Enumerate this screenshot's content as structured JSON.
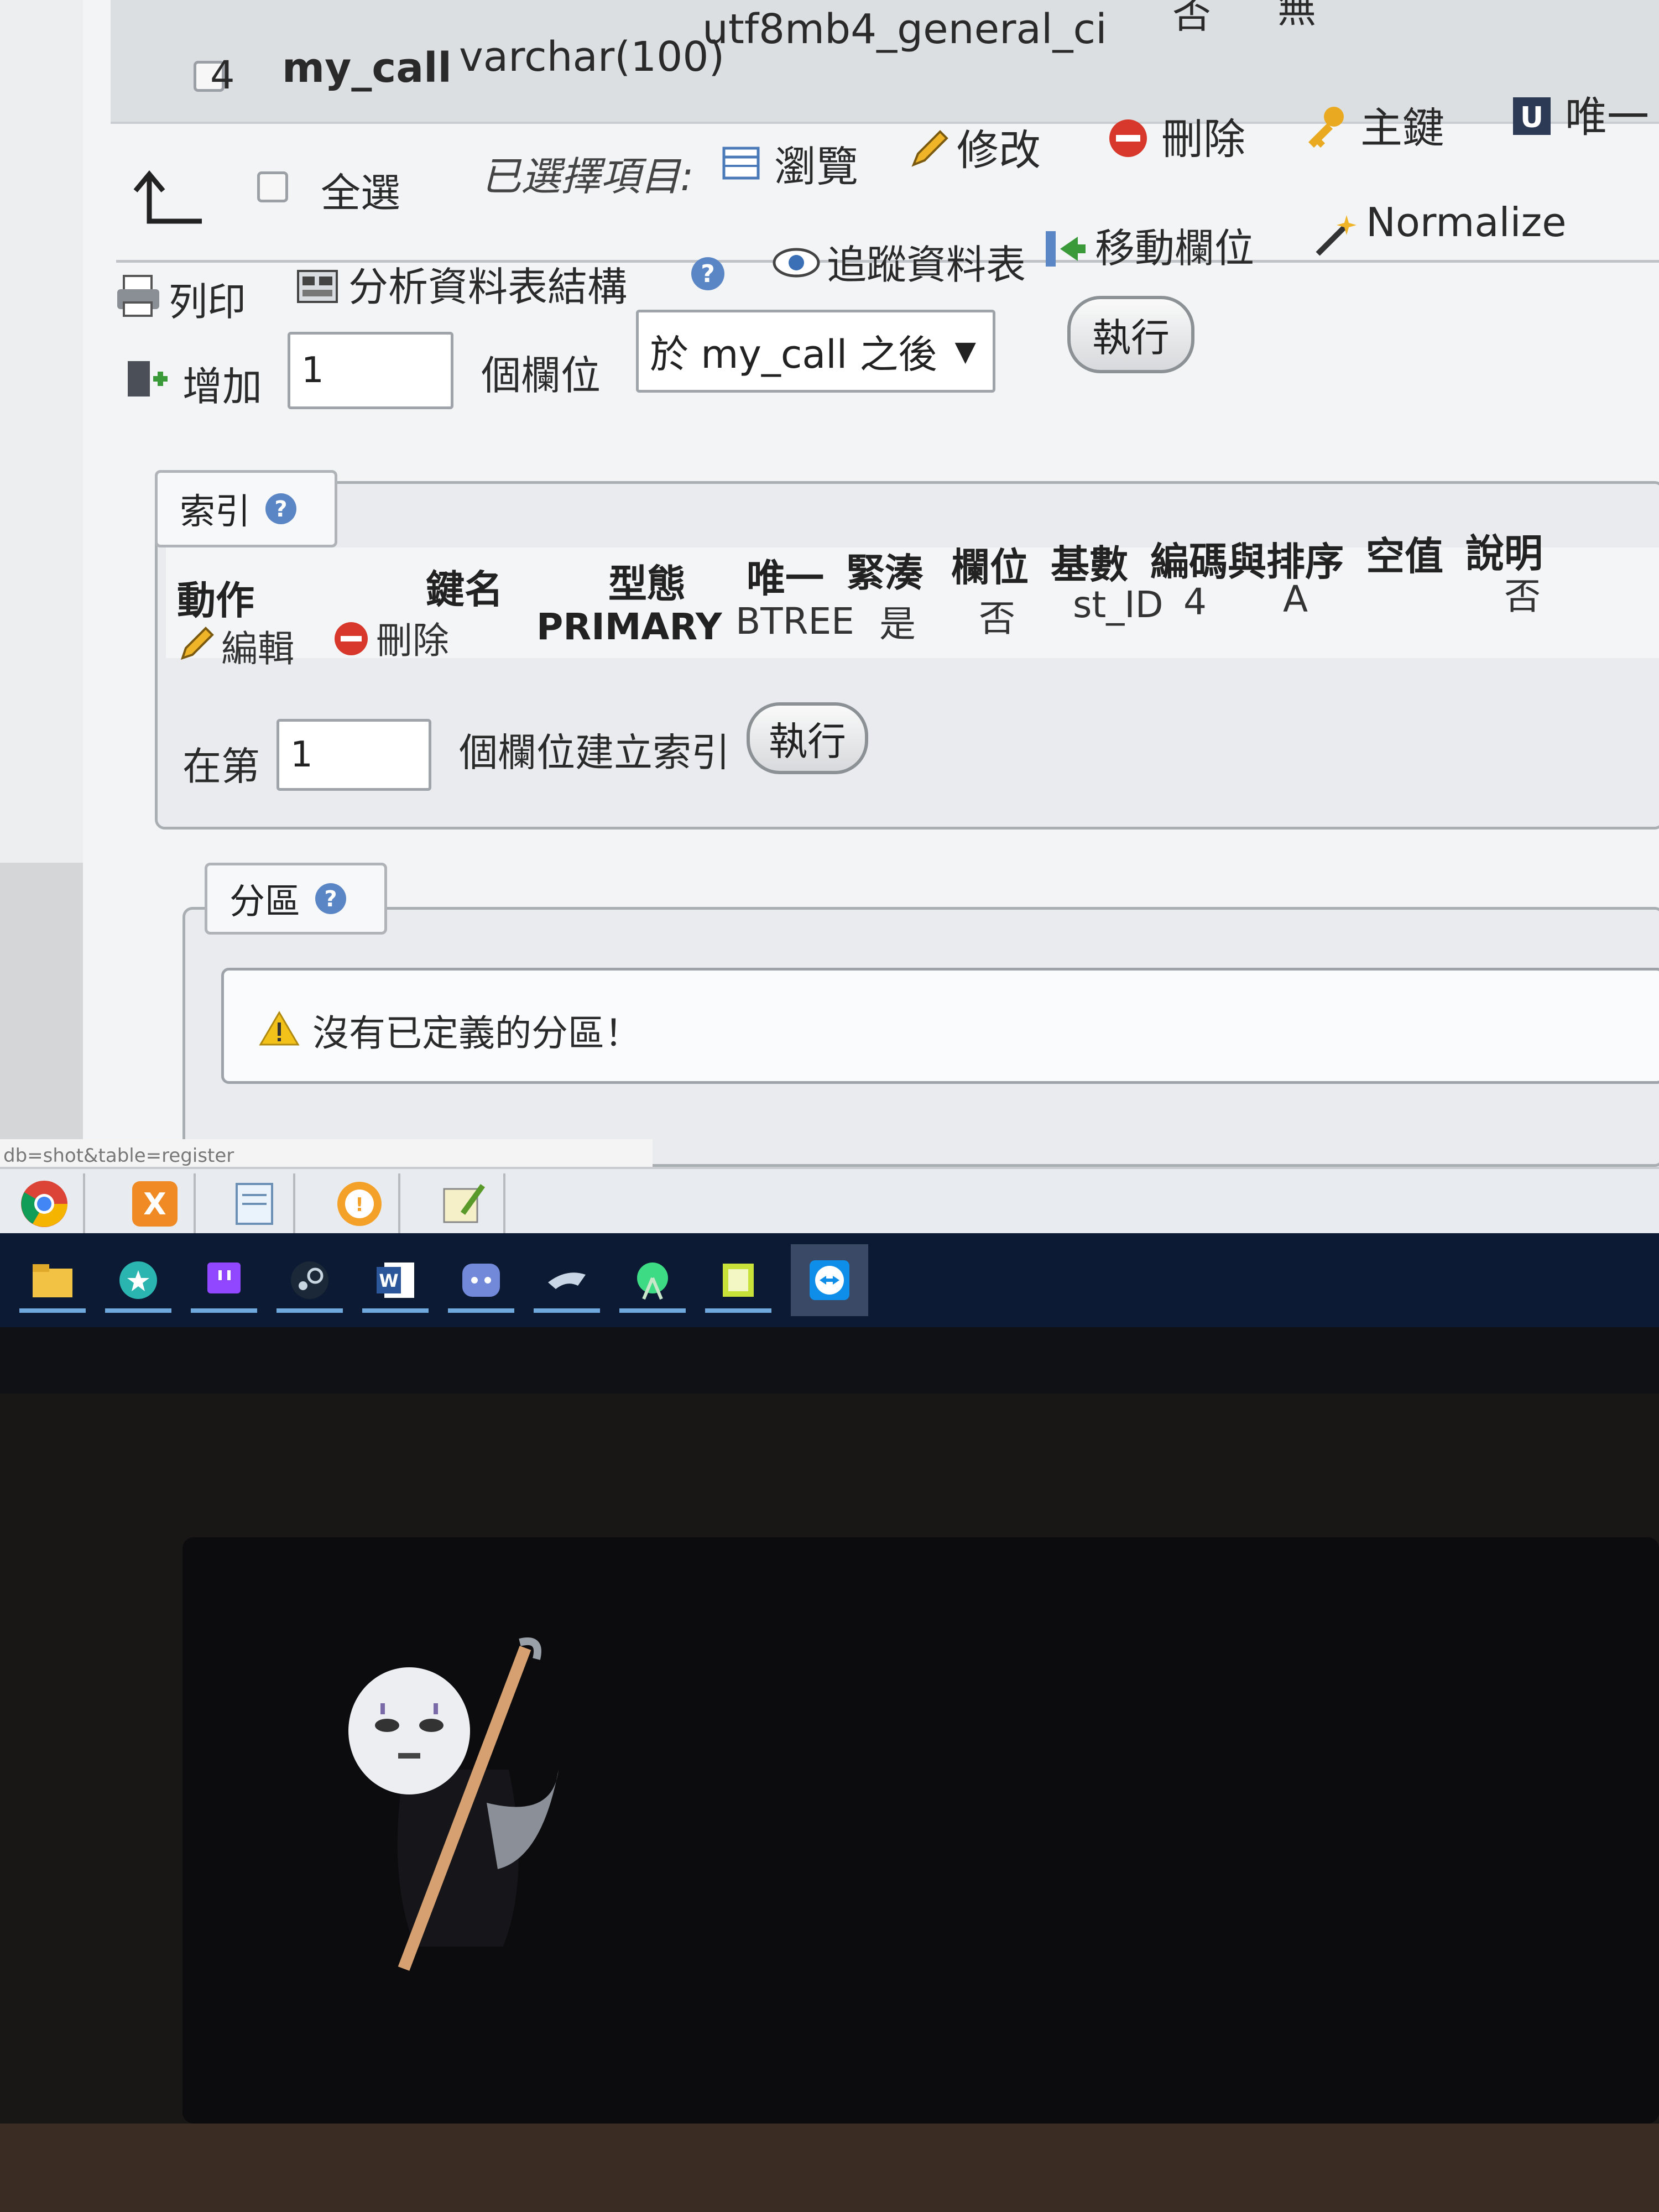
{
  "structure_row": {
    "number": "4",
    "name": "my_call",
    "type": "varchar(100)",
    "collation": "utf8mb4_general_ci",
    "attributes_partial": "否",
    "extra_partial": "無"
  },
  "selection_bar": {
    "select_all": "全選",
    "with_selected": "已選擇項目:",
    "browse": "瀏覽",
    "change": "修改",
    "drop": "刪除",
    "primary": "主鍵",
    "unique": "唯一"
  },
  "toolbar": {
    "print": "列印",
    "analyze": "分析資料表結構",
    "track": "追蹤資料表",
    "move_columns": "移動欄位",
    "normalize": "Normalize"
  },
  "add_columns": {
    "label": "增加",
    "count": "1",
    "unit": "個欄位",
    "position": "於 my_call 之後",
    "go": "執行"
  },
  "indexes": {
    "legend": "索引",
    "headers": {
      "action": "動作",
      "keyname": "鍵名",
      "type": "型態",
      "unique": "唯一",
      "packed": "緊湊",
      "column": "欄位",
      "cardinality": "基數",
      "collation": "編碼與排序",
      "null": "空值",
      "comment": "說明"
    },
    "row": {
      "edit": "編輯",
      "drop": "刪除",
      "keyname": "PRIMARY",
      "type": "BTREE",
      "unique": "是",
      "packed": "否",
      "column": "st_ID",
      "cardinality": "4",
      "collation": "A",
      "null": "否"
    },
    "create": {
      "prefix": "在第",
      "value": "1",
      "suffix": "個欄位建立索引",
      "go": "執行"
    }
  },
  "partitions": {
    "legend": "分區",
    "message": "沒有已定義的分區！"
  },
  "status_url": "db=shot&table=register",
  "taskbar_icons": [
    "file-explorer-icon",
    "store-icon",
    "twitch-icon",
    "steam-icon",
    "word-icon",
    "discord-icon",
    "game-icon",
    "android-studio-icon",
    "notes-icon",
    "teamviewer-icon"
  ],
  "quicklaunch_icons": [
    "chrome-icon",
    "xampp-icon",
    "notepad-icon",
    "alert-app-icon",
    "image-editor-icon"
  ],
  "colors": {
    "taskbar": "#0d1a33",
    "screen_bg": "#f3f4f5",
    "link_icon_blue": "#3b6fb6",
    "drop_red": "#d8382b",
    "warning_yellow": "#f2c21b"
  }
}
